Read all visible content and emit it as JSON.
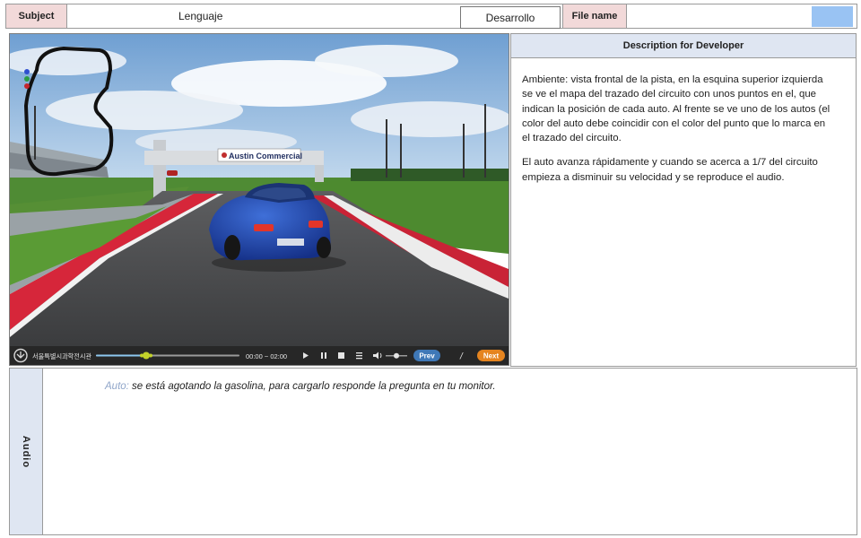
{
  "header": {
    "subject_label": "Subject",
    "subject_value": "Lenguaje",
    "stage_value": "Desarrollo",
    "filename_label": "File name",
    "filename_value": "",
    "accent_color": "#99c3f3"
  },
  "video": {
    "billboard_text": "Austin Commercial",
    "player": {
      "brand_text": "서울특별시과학전시관",
      "time_text": "00:00 ~ 02:00",
      "progress_fraction": 0.35,
      "volume_fraction": 0.5,
      "prev_label": "Prev",
      "separator": "/",
      "next_label": "Next",
      "icons": [
        "logo-icon",
        "play-icon",
        "pause-icon",
        "stop-icon",
        "menu-icon",
        "volume-icon"
      ]
    }
  },
  "description": {
    "title": "Description for Developer",
    "paragraphs": [
      "Ambiente: vista frontal de la pista, en la esquina superior izquierda se ve el mapa del trazado del circuito con unos puntos en el, que indican la posición de cada auto. Al frente se ve uno de los autos (el color del auto debe coincidir con el color del punto que lo marca en el trazado del circuito.",
      "El auto avanza rápidamente y cuando se acerca a 1/7 del circuito empieza a disminuir su velocidad y se reproduce el audio."
    ]
  },
  "audio": {
    "label": "Audio",
    "speaker": "Auto:",
    "line": " se está agotando la gasolina, para cargarlo responde la pregunta en tu monitor."
  }
}
